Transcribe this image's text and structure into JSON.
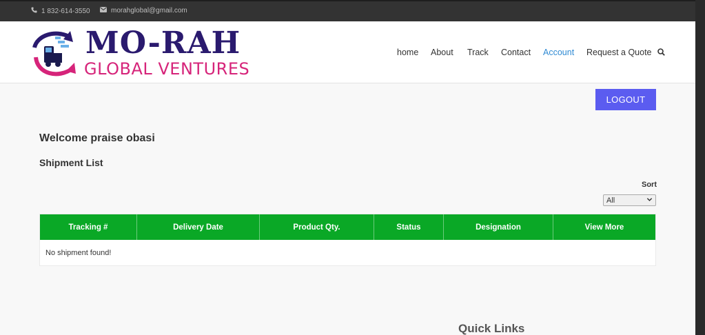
{
  "topbar": {
    "phone": "1 832-614-3550",
    "email": "morahglobal@gmail.com",
    "phone_icon": "phone-icon",
    "email_icon": "envelope-icon"
  },
  "logo": {
    "line1": "MO-RAH",
    "line2": "GLOBAL VENTURES"
  },
  "nav": {
    "items": [
      {
        "label": "home"
      },
      {
        "label": "About"
      },
      {
        "label": "Track"
      },
      {
        "label": "Contact"
      },
      {
        "label": "Account",
        "active": true
      },
      {
        "label": "Request a Quote"
      }
    ],
    "search_icon": "search-icon",
    "active_color": "#2f8ad3"
  },
  "account": {
    "logout_label": "LOGOUT",
    "welcome": "Welcome praise obasi",
    "section_title": "Shipment List"
  },
  "sort": {
    "label": "Sort",
    "selected": "All"
  },
  "table": {
    "headers": [
      "Tracking #",
      "Delivery Date",
      "Product Qty.",
      "Status",
      "Designation",
      "View More"
    ],
    "empty_message": "No shipment found!",
    "header_color": "#0aa826"
  },
  "footer": {
    "quick_links_title": "Quick Links"
  },
  "colors": {
    "brand_navy": "#2a1a6e",
    "brand_pink": "#d6247a",
    "logout_button": "#5b5cf0"
  }
}
